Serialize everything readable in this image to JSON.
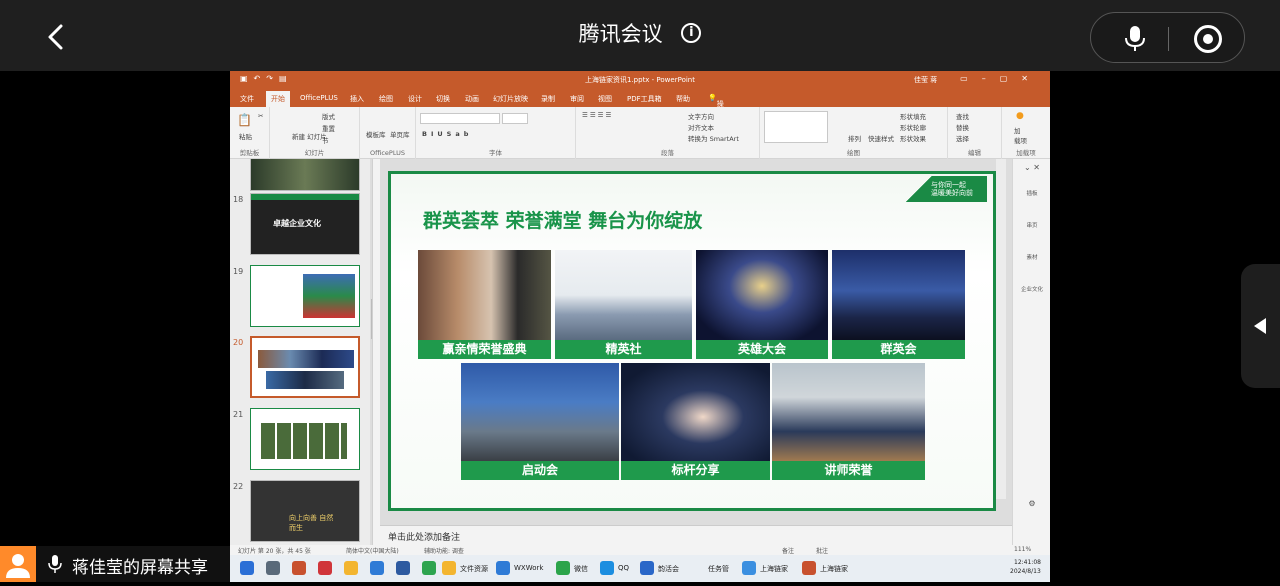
{
  "meeting": {
    "title": "腾讯会议",
    "info_icon": "i",
    "share_banner": "蒋佳莹的屏幕共享"
  },
  "ppt": {
    "filename": "上海链家资讯1.pptx - PowerPoint",
    "user": "佳莹 蒋",
    "menu": [
      "文件",
      "开始",
      "OfficePLUS",
      "插入",
      "绘图",
      "设计",
      "切换",
      "动画",
      "幻灯片放映",
      "录制",
      "审阅",
      "视图",
      "PDF工具箱",
      "帮助",
      "操作说明搜索"
    ],
    "active_menu": "开始",
    "ribbon_groups": [
      "剪贴板",
      "幻灯片",
      "OfficePLUS",
      "字体",
      "段落",
      "绘图",
      "编辑",
      "加载项"
    ],
    "ribbon_items": {
      "paste": "粘贴",
      "new_slide": "新建\n幻灯片",
      "layout": "版式",
      "reset": "重置",
      "section": "节",
      "model": "模板库",
      "single": "单页库",
      "text_dir": "文字方向",
      "align_text": "对齐文本",
      "smartart": "转换为 SmartArt",
      "arrange": "排列",
      "quick_style": "快速样式",
      "fill": "形状填充",
      "outline": "形状轮廓",
      "effect": "形状效果",
      "find": "查找",
      "replace": "替换",
      "select": "选择",
      "addin": "加\n载项"
    },
    "thumb_numbers": [
      "18",
      "19",
      "20",
      "21",
      "22"
    ],
    "thumb_texts": {
      "t18": "卓越企业文化",
      "t22": "向上向善 自然而生"
    },
    "notes_placeholder": "单击此处添加备注",
    "status_left": "幻灯片 第 20 张，共 45 张",
    "status_lang": "简体中文(中国大陆)",
    "status_access": "辅助功能: 调查",
    "status_notes": "备注",
    "status_comments": "批注",
    "zoom": "111%",
    "task_pane": [
      "插板",
      "串页",
      "素材",
      "企业文化"
    ]
  },
  "slide": {
    "title": "群英荟萃 荣誉满堂 舞台为你绽放",
    "logo_text": "与你同一起\n温暖美好向前",
    "photos_row1": [
      "赢亲情荣誉盛典",
      "精英社",
      "英雄大会",
      "群英会"
    ],
    "photos_row2": [
      "启动会",
      "标杆分享",
      "讲师荣誉"
    ]
  },
  "taskbar": {
    "items": [
      "文件资源",
      "WXWork",
      "微信",
      "QQ",
      "韵活会",
      "任务管",
      "上海链家",
      "上海链家"
    ],
    "time": "12:41:08",
    "date": "2024/8/13"
  },
  "colors": {
    "ppt_orange": "#c55a2b",
    "slide_green": "#1a8a45",
    "caption_green": "#1f9a4c",
    "meeting_bar": "#1f1f1f"
  }
}
